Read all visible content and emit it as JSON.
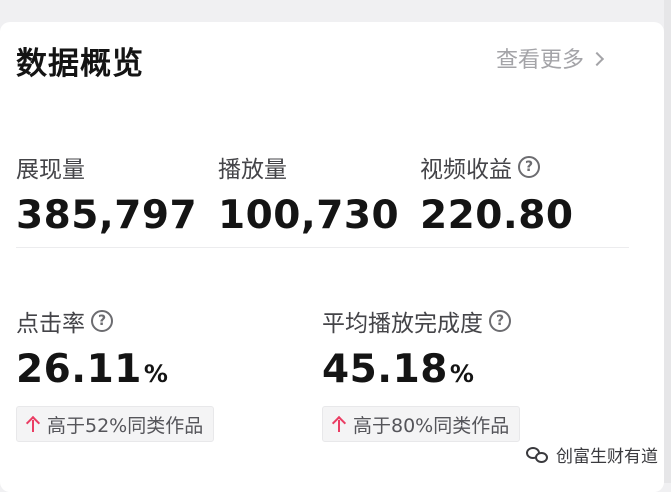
{
  "header": {
    "title": "数据概览",
    "more_label": "查看更多"
  },
  "metrics": {
    "impressions": {
      "label": "展现量",
      "value": "385,797"
    },
    "plays": {
      "label": "播放量",
      "value": "100,730"
    },
    "revenue": {
      "label": "视频收益",
      "value": "220.80"
    },
    "ctr": {
      "label": "点击率",
      "value": "26.11",
      "unit": "%",
      "compare": "高于52%同类作品"
    },
    "completion": {
      "label": "平均播放完成度",
      "value": "45.18",
      "unit": "%",
      "compare": "高于80%同类作品"
    }
  },
  "watermark": {
    "text": "创富生财有道"
  },
  "colors": {
    "up_arrow": "#ea3d63",
    "muted": "#a4a4a8"
  }
}
